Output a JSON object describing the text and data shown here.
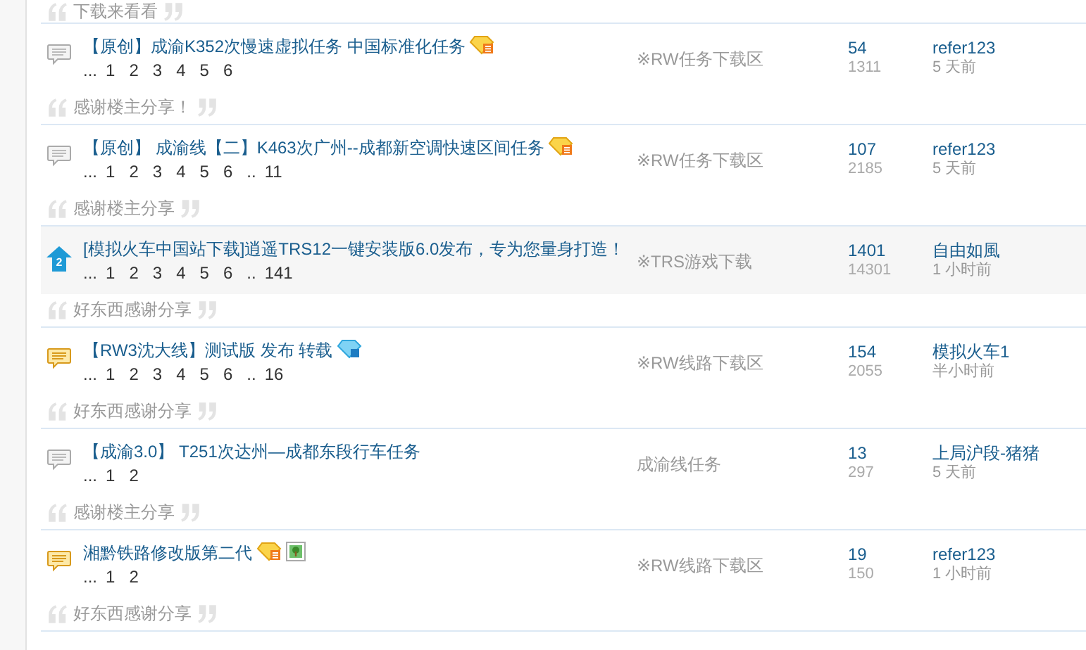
{
  "top_quote": "下载来看看",
  "threads": [
    {
      "kind": "normal",
      "title": "【原创】成渝K352次慢速虚拟任务 中国标准化任务",
      "badges": [
        {
          "kind": "gem-gold"
        }
      ],
      "pages_prefix": "...",
      "pages": [
        "1",
        "2",
        "3",
        "4",
        "5",
        "6"
      ],
      "forum": "※RW任务下载区",
      "replies": "54",
      "views": "1311",
      "last_poster": "refer123",
      "last_time": "5 天前",
      "quote": "感谢楼主分享！"
    },
    {
      "kind": "normal",
      "title": "【原创】 成渝线【二】K463次广州--成都新空调快速区间任务",
      "badges": [
        {
          "kind": "gem-gold"
        }
      ],
      "pages_prefix": "...",
      "pages": [
        "1",
        "2",
        "3",
        "4",
        "5",
        "6"
      ],
      "pages_gap": "..",
      "last_page": "11",
      "forum": "※RW任务下载区",
      "replies": "107",
      "views": "2185",
      "last_poster": "refer123",
      "last_time": "5 天前",
      "quote": "感谢楼主分享"
    },
    {
      "kind": "pinned",
      "icon_label": "2",
      "title": "[模拟火车中国站下载]逍遥TRS12一键安装版6.0发布，专为您量身打造！",
      "pages_prefix": "...",
      "pages": [
        "1",
        "2",
        "3",
        "4",
        "5",
        "6"
      ],
      "pages_gap": "..",
      "last_page": "141",
      "forum": "※TRS游戏下载",
      "replies": "1401",
      "views": "14301",
      "last_poster": "自由如風",
      "last_time": "1 小时前",
      "quote": "好东西感谢分享"
    },
    {
      "kind": "hot",
      "title": "【RW3沈大线】测试版 发布 转载",
      "badges": [
        {
          "kind": "gem-blue"
        }
      ],
      "pages_prefix": "...",
      "pages": [
        "1",
        "2",
        "3",
        "4",
        "5",
        "6"
      ],
      "pages_gap": "..",
      "last_page": "16",
      "forum": "※RW线路下载区",
      "replies": "154",
      "views": "2055",
      "last_poster": "模拟火车1",
      "last_time": "半小时前",
      "quote": "好东西感谢分享"
    },
    {
      "kind": "normal",
      "title": "【成渝3.0】 T251次达州—成都东段行车任务",
      "pages_prefix": "...",
      "pages": [
        "1",
        "2"
      ],
      "forum": "成渝线任务",
      "replies": "13",
      "views": "297",
      "last_poster": "上局沪段-猪猪",
      "last_time": "5 天前",
      "quote": "感谢楼主分享"
    },
    {
      "kind": "hot",
      "title": "湘黔铁路修改版第二代",
      "badges": [
        {
          "kind": "gem-gold"
        },
        {
          "kind": "image"
        }
      ],
      "pages_prefix": "...",
      "pages": [
        "1",
        "2"
      ],
      "forum": "※RW线路下载区",
      "replies": "19",
      "views": "150",
      "last_poster": "refer123",
      "last_time": "1 小时前",
      "quote": "好东西感谢分享"
    }
  ]
}
